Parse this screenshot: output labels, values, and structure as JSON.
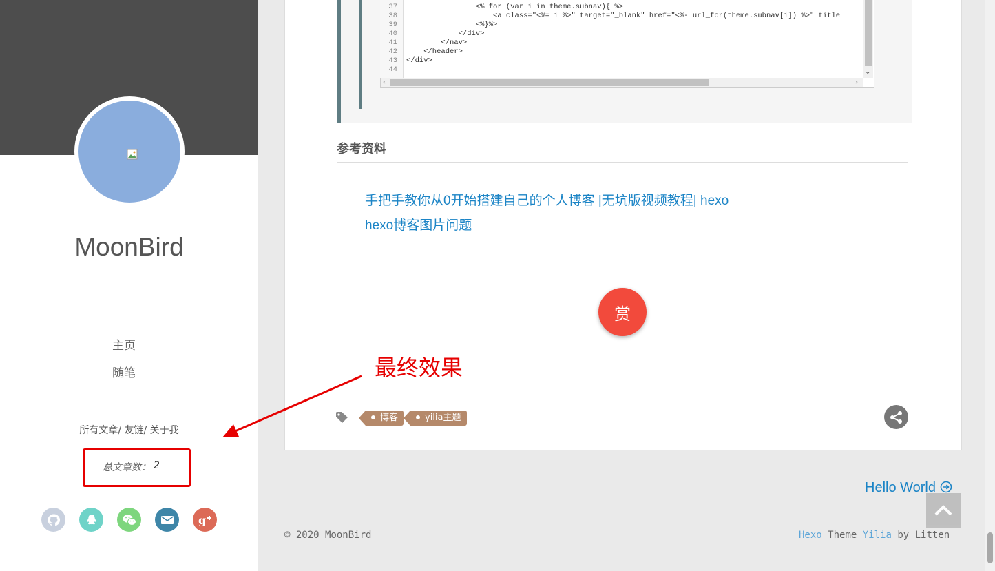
{
  "sidebar": {
    "site_title": "MoonBird",
    "nav": [
      {
        "label": "主页"
      },
      {
        "label": "随笔"
      }
    ],
    "links": [
      {
        "label": "所有文章"
      },
      {
        "label": "友链"
      },
      {
        "label": "关于我"
      }
    ],
    "link_separator": "/",
    "post_count_label": "总文章数：",
    "post_count_value": "2",
    "social": [
      {
        "icon": "github-icon",
        "color": "#c8d0de"
      },
      {
        "icon": "qq-icon",
        "color": "#6fd3c8"
      },
      {
        "icon": "wechat-icon",
        "color": "#7ed67e"
      },
      {
        "icon": "mail-icon",
        "color": "#3e86a8"
      },
      {
        "icon": "google-plus-icon",
        "color": "#dc6a57"
      }
    ]
  },
  "code": {
    "lines": [
      {
        "num": "37",
        "text": "                <% for (var i in theme.subnav){ %>"
      },
      {
        "num": "38",
        "text": "                    <a class=\"<%= i %>\" target=\"_blank\" href=\"<%- url_for(theme.subnav[i]) %>\" title"
      },
      {
        "num": "39",
        "text": "                <%}%>"
      },
      {
        "num": "40",
        "text": "            </div>"
      },
      {
        "num": "41",
        "text": "        </nav>"
      },
      {
        "num": "42",
        "text": "    </header>"
      },
      {
        "num": "43",
        "text": "</div>"
      },
      {
        "num": "44",
        "text": ""
      }
    ]
  },
  "article": {
    "references_heading": "参考资料",
    "references": [
      {
        "label": "手把手教你从0开始搭建自己的个人博客 |无坑版视频教程| hexo"
      },
      {
        "label": "hexo博客图片问题"
      }
    ],
    "reward_label": "赏",
    "annotation": "最终效果",
    "tags": [
      {
        "label": "博客"
      },
      {
        "label": "yilia主题"
      }
    ],
    "next_post_label": "Hello World"
  },
  "footer": {
    "copyright": "© 2020 MoonBird",
    "theme_prefix": "Hexo",
    "theme_word": "Theme",
    "theme_name": "Yilia",
    "theme_by": "by Litten"
  },
  "colors": {
    "accent_link": "#1b84c6",
    "reward": "#f24a3c",
    "annotation_red": "#e60000",
    "tag": "#b5896a"
  }
}
